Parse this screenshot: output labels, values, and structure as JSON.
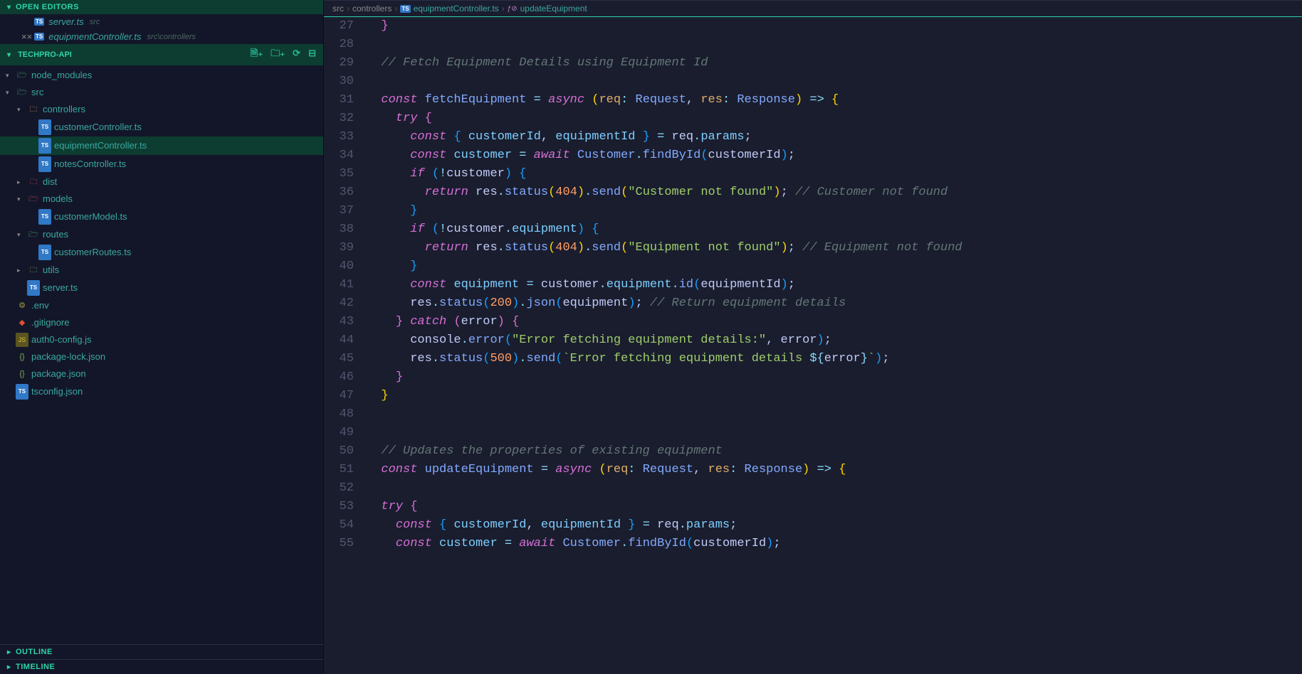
{
  "sidebar": {
    "openEditorsLabel": "OPEN EDITORS",
    "openEditors": [
      {
        "name": "server.ts",
        "path": "src",
        "modified": false
      },
      {
        "name": "equipmentController.ts",
        "path": "src\\controllers",
        "modified": true
      }
    ],
    "projectName": "TECHPRO-API",
    "outlineLabel": "OUTLINE",
    "timelineLabel": "TIMELINE",
    "tree": [
      {
        "label": "node_modules",
        "type": "folder",
        "indent": 0,
        "expanded": true,
        "iconClass": "folder-src"
      },
      {
        "label": "src",
        "type": "folder",
        "indent": 0,
        "expanded": true,
        "iconClass": "folder-src"
      },
      {
        "label": "controllers",
        "type": "folder",
        "indent": 1,
        "expanded": true,
        "iconClass": "folder"
      },
      {
        "label": "customerController.ts",
        "type": "file",
        "indent": 2,
        "iconClass": "ts"
      },
      {
        "label": "equipmentController.ts",
        "type": "file",
        "indent": 2,
        "iconClass": "ts",
        "selected": true
      },
      {
        "label": "notesController.ts",
        "type": "file",
        "indent": 2,
        "iconClass": "ts"
      },
      {
        "label": "dist",
        "type": "folder",
        "indent": 1,
        "expanded": false,
        "iconClass": "folder-dist"
      },
      {
        "label": "models",
        "type": "folder",
        "indent": 1,
        "expanded": true,
        "iconClass": "folder-models"
      },
      {
        "label": "customerModel.ts",
        "type": "file",
        "indent": 2,
        "iconClass": "ts"
      },
      {
        "label": "routes",
        "type": "folder",
        "indent": 1,
        "expanded": true,
        "iconClass": "folder-src"
      },
      {
        "label": "customerRoutes.ts",
        "type": "file",
        "indent": 2,
        "iconClass": "ts"
      },
      {
        "label": "utils",
        "type": "folder",
        "indent": 1,
        "expanded": false,
        "iconClass": "folder-utils"
      },
      {
        "label": "server.ts",
        "type": "file",
        "indent": 1,
        "iconClass": "ts"
      },
      {
        "label": ".env",
        "type": "file",
        "indent": 0,
        "iconClass": "env"
      },
      {
        "label": ".gitignore",
        "type": "file",
        "indent": 0,
        "iconClass": "git"
      },
      {
        "label": "auth0-config.js",
        "type": "file",
        "indent": 0,
        "iconClass": "js"
      },
      {
        "label": "package-lock.json",
        "type": "file",
        "indent": 0,
        "iconClass": "json"
      },
      {
        "label": "package.json",
        "type": "file",
        "indent": 0,
        "iconClass": "json"
      },
      {
        "label": "tsconfig.json",
        "type": "file",
        "indent": 0,
        "iconClass": "ts"
      }
    ]
  },
  "breadcrumbs": {
    "parts": [
      "src",
      "controllers",
      "equipmentController.ts",
      "updateEquipment"
    ]
  },
  "code": {
    "startLine": 27,
    "lines": [
      {
        "n": 27,
        "html": "  <span class='tk-brace2'>}</span>"
      },
      {
        "n": 28,
        "html": ""
      },
      {
        "n": 29,
        "html": "  <span class='tk-comment'>// Fetch Equipment Details using Equipment Id</span>"
      },
      {
        "n": 30,
        "html": ""
      },
      {
        "n": 31,
        "html": "  <span class='tk-kw'>const</span> <span class='tk-const'>fetchEquipment</span> <span class='tk-op'>=</span> <span class='tk-kw'>async</span> <span class='tk-brace1'>(</span><span class='tk-param'>req</span><span class='tk-op'>:</span> <span class='tk-type'>Request</span><span class='tk-punc'>,</span> <span class='tk-param'>res</span><span class='tk-op'>:</span> <span class='tk-type'>Response</span><span class='tk-brace1'>)</span> <span class='tk-op'>=&gt;</span> <span class='tk-brace1'>{</span>"
      },
      {
        "n": 32,
        "html": "    <span class='tk-kw'>try</span> <span class='tk-brace2'>{</span>"
      },
      {
        "n": 33,
        "html": "      <span class='tk-kw'>const</span> <span class='tk-brace3'>{</span> <span class='tk-var2'>customerId</span><span class='tk-punc'>,</span> <span class='tk-var2'>equipmentId</span> <span class='tk-brace3'>}</span> <span class='tk-op'>=</span> <span class='tk-def'>req</span><span class='tk-op'>.</span><span class='tk-prop'>params</span><span class='tk-punc'>;</span>"
      },
      {
        "n": 34,
        "html": "      <span class='tk-kw'>const</span> <span class='tk-var2'>customer</span> <span class='tk-op'>=</span> <span class='tk-kw'>await</span> <span class='tk-type'>Customer</span><span class='tk-op'>.</span><span class='tk-method'>findById</span><span class='tk-brace3'>(</span><span class='tk-def'>customerId</span><span class='tk-brace3'>)</span><span class='tk-punc'>;</span>"
      },
      {
        "n": 35,
        "html": "      <span class='tk-kw'>if</span> <span class='tk-brace3'>(</span><span class='tk-op'>!</span><span class='tk-def'>customer</span><span class='tk-brace3'>)</span> <span class='tk-brace3'>{</span>"
      },
      {
        "n": 36,
        "html": "        <span class='tk-kw'>return</span> <span class='tk-def'>res</span><span class='tk-op'>.</span><span class='tk-method'>status</span><span class='tk-brace1'>(</span><span class='tk-num'>404</span><span class='tk-brace1'>)</span><span class='tk-op'>.</span><span class='tk-method'>send</span><span class='tk-brace1'>(</span><span class='tk-str'>\"Customer not found\"</span><span class='tk-brace1'>)</span><span class='tk-punc'>;</span> <span class='tk-comment'>// Customer not found</span>"
      },
      {
        "n": 37,
        "html": "      <span class='tk-brace3'>}</span>"
      },
      {
        "n": 38,
        "html": "      <span class='tk-kw'>if</span> <span class='tk-brace3'>(</span><span class='tk-op'>!</span><span class='tk-def'>customer</span><span class='tk-op'>.</span><span class='tk-prop'>equipment</span><span class='tk-brace3'>)</span> <span class='tk-brace3'>{</span>"
      },
      {
        "n": 39,
        "html": "        <span class='tk-kw'>return</span> <span class='tk-def'>res</span><span class='tk-op'>.</span><span class='tk-method'>status</span><span class='tk-brace1'>(</span><span class='tk-num'>404</span><span class='tk-brace1'>)</span><span class='tk-op'>.</span><span class='tk-method'>send</span><span class='tk-brace1'>(</span><span class='tk-str'>\"Equipment not found\"</span><span class='tk-brace1'>)</span><span class='tk-punc'>;</span> <span class='tk-comment'>// Equipment not found</span>"
      },
      {
        "n": 40,
        "html": "      <span class='tk-brace3'>}</span>"
      },
      {
        "n": 41,
        "html": "      <span class='tk-kw'>const</span> <span class='tk-var2'>equipment</span> <span class='tk-op'>=</span> <span class='tk-def'>customer</span><span class='tk-op'>.</span><span class='tk-prop'>equipment</span><span class='tk-op'>.</span><span class='tk-method'>id</span><span class='tk-brace3'>(</span><span class='tk-def'>equipmentId</span><span class='tk-brace3'>)</span><span class='tk-punc'>;</span>"
      },
      {
        "n": 42,
        "html": "      <span class='tk-def'>res</span><span class='tk-op'>.</span><span class='tk-method'>status</span><span class='tk-brace3'>(</span><span class='tk-num'>200</span><span class='tk-brace3'>)</span><span class='tk-op'>.</span><span class='tk-method'>json</span><span class='tk-brace3'>(</span><span class='tk-def'>equipment</span><span class='tk-brace3'>)</span><span class='tk-punc'>;</span> <span class='tk-comment'>// Return equipment details</span>"
      },
      {
        "n": 43,
        "html": "    <span class='tk-brace2'>}</span> <span class='tk-kw'>catch</span> <span class='tk-brace2'>(</span><span class='tk-def'>error</span><span class='tk-brace2'>)</span> <span class='tk-brace2'>{</span>"
      },
      {
        "n": 44,
        "html": "      <span class='tk-def'>console</span><span class='tk-op'>.</span><span class='tk-method'>error</span><span class='tk-brace3'>(</span><span class='tk-str'>\"Error fetching equipment details:\"</span><span class='tk-punc'>,</span> <span class='tk-def'>error</span><span class='tk-brace3'>)</span><span class='tk-punc'>;</span>"
      },
      {
        "n": 45,
        "html": "      <span class='tk-def'>res</span><span class='tk-op'>.</span><span class='tk-method'>status</span><span class='tk-brace3'>(</span><span class='tk-num'>500</span><span class='tk-brace3'>)</span><span class='tk-op'>.</span><span class='tk-method'>send</span><span class='tk-brace3'>(</span><span class='tk-str'>`Error fetching equipment details </span><span class='tk-op'>${</span><span class='tk-def'>error</span><span class='tk-op'>}</span><span class='tk-str'>`</span><span class='tk-brace3'>)</span><span class='tk-punc'>;</span>"
      },
      {
        "n": 46,
        "html": "    <span class='tk-brace2'>}</span>"
      },
      {
        "n": 47,
        "html": "  <span class='tk-brace1'>}</span>"
      },
      {
        "n": 48,
        "html": ""
      },
      {
        "n": 49,
        "html": ""
      },
      {
        "n": 50,
        "html": "  <span class='tk-comment'>// Updates the properties of existing equipment</span>"
      },
      {
        "n": 51,
        "html": "  <span class='tk-kw'>const</span> <span class='tk-const'>updateEquipment</span> <span class='tk-op'>=</span> <span class='tk-kw'>async</span> <span class='tk-brace1'>(</span><span class='tk-param'>req</span><span class='tk-op'>:</span> <span class='tk-type'>Request</span><span class='tk-punc'>,</span> <span class='tk-param'>res</span><span class='tk-op'>:</span> <span class='tk-type'>Response</span><span class='tk-brace1'>)</span> <span class='tk-op'>=&gt;</span> <span class='tk-brace1'>{</span>"
      },
      {
        "n": 52,
        "html": ""
      },
      {
        "n": 53,
        "html": "  <span class='tk-kw'>try</span> <span class='tk-brace2'>{</span>"
      },
      {
        "n": 54,
        "html": "    <span class='tk-kw'>const</span> <span class='tk-brace3'>{</span> <span class='tk-var2'>customerId</span><span class='tk-punc'>,</span> <span class='tk-var2'>equipmentId</span> <span class='tk-brace3'>}</span> <span class='tk-op'>=</span> <span class='tk-def'>req</span><span class='tk-op'>.</span><span class='tk-prop'>params</span><span class='tk-punc'>;</span>"
      },
      {
        "n": 55,
        "html": "    <span class='tk-kw'>const</span> <span class='tk-var2'>customer</span> <span class='tk-op'>=</span> <span class='tk-kw'>await</span> <span class='tk-type'>Customer</span><span class='tk-op'>.</span><span class='tk-method'>findById</span><span class='tk-brace3'>(</span><span class='tk-def'>customerId</span><span class='tk-brace3'>)</span><span class='tk-punc'>;</span>"
      }
    ]
  }
}
